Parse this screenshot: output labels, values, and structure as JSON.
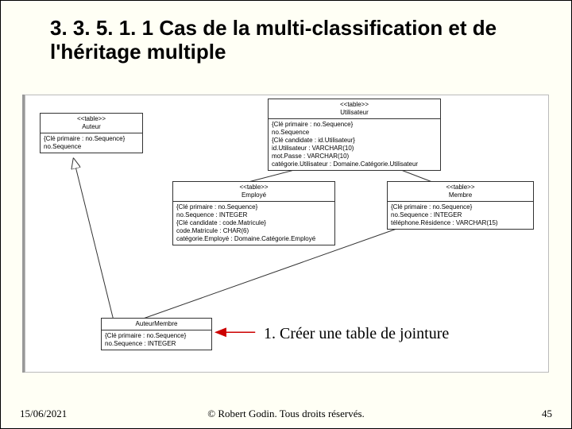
{
  "title": "3. 3. 5. 1. 1 Cas de la multi-classification et de l'héritage multiple",
  "classes": {
    "auteur": {
      "stereotype": "<<table>>",
      "name": "Auteur",
      "constraint": "{Clé primaire : no.Sequence}",
      "attr1": "no.Sequence"
    },
    "utilisateur": {
      "stereotype": "<<table>>",
      "name": "Utilisateur",
      "constraint1": "{Clé primaire : no.Sequence}",
      "attr1": "no.Sequence",
      "constraint2": "{Clé candidate : id.Utilisateur}",
      "attr2": "id.Utilisateur : VARCHAR(10)",
      "attr3": "mot.Passe : VARCHAR(10)",
      "attr4": "catégorie.Utilisateur : Domaine.Catégorie.Utilisateur"
    },
    "employe": {
      "stereotype": "<<table>>",
      "name": "Employé",
      "constraint1": "{Clé primaire : no.Sequence}",
      "attr1": "no.Sequence : INTEGER",
      "constraint2": "{Clé candidate : code.Matricule}",
      "attr2": "code.Matricule : CHAR(6)",
      "attr3": "catégorie.Employé : Domaine.Catégorie.Employé"
    },
    "membre": {
      "stereotype": "<<table>>",
      "name": "Membre",
      "constraint1": "{Clé primaire : no.Sequence}",
      "attr1": "no.Sequence : INTEGER",
      "attr2": "téléphone.Résidence : VARCHAR(15)"
    },
    "auteurmembre": {
      "name": "AuteurMembre",
      "constraint": "{Clé primaire : no.Sequence}",
      "attr1": "no.Sequence : INTEGER"
    }
  },
  "annotation": "1. Créer une table de jointure",
  "footer": {
    "date": "15/06/2021",
    "copyright": "© Robert Godin. Tous droits réservés.",
    "page": "45"
  }
}
